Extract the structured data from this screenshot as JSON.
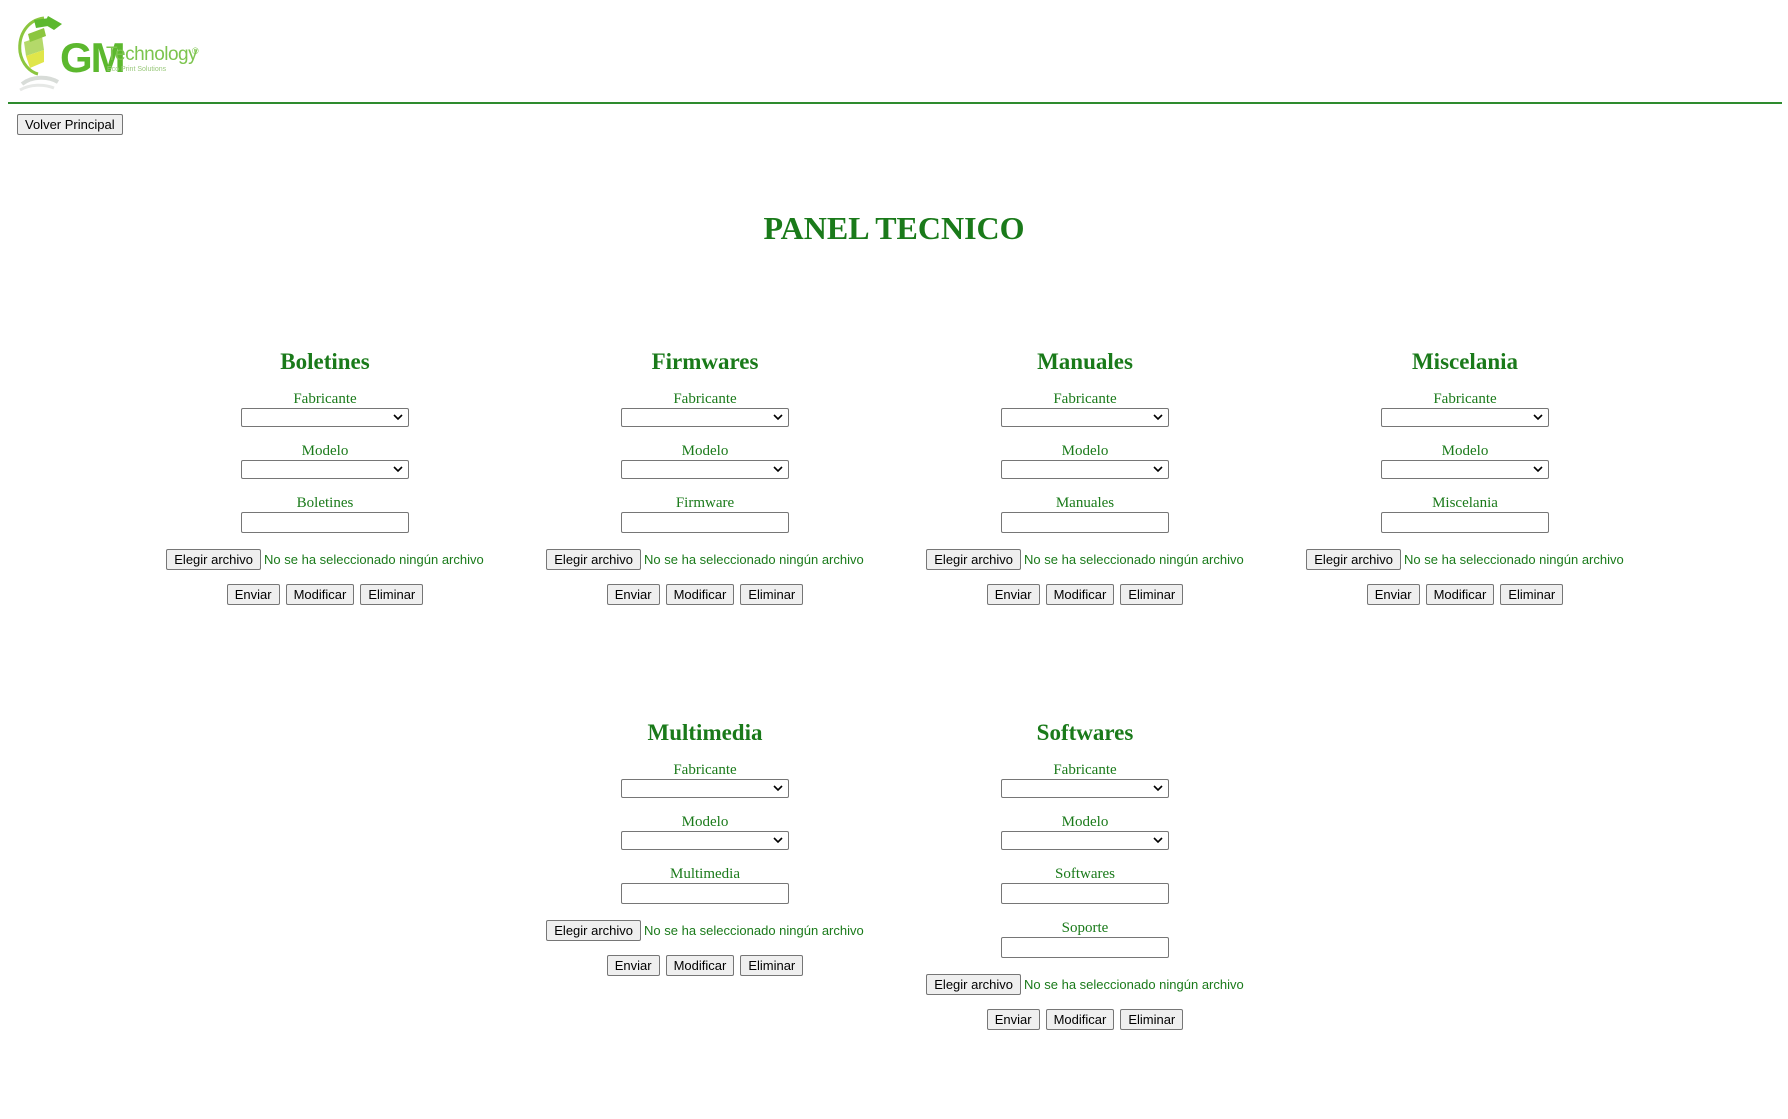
{
  "header": {
    "logo_gm": "GM",
    "logo_technology": "Technology",
    "logo_tagline": "Eco Print Solutions",
    "brand_color": "#5cb82e",
    "rule_color": "#2e8b2e"
  },
  "nav": {
    "back_label": "Volver Principal"
  },
  "page": {
    "title": "PANEL TECNICO",
    "text_color": "#1a7a1a"
  },
  "common": {
    "manufacturer_label": "Fabricante",
    "model_label": "Modelo",
    "choose_file_label": "Elegir archivo",
    "no_file_text": "No se ha seleccionado ningún archivo",
    "send_label": "Enviar",
    "modify_label": "Modificar",
    "delete_label": "Eliminar",
    "chevron_icon": "chevron-down-icon"
  },
  "sections": [
    {
      "title": "Boletines",
      "field_label": "Boletines"
    },
    {
      "title": "Firmwares",
      "field_label": "Firmware"
    },
    {
      "title": "Manuales",
      "field_label": "Manuales"
    },
    {
      "title": "Miscelania",
      "field_label": "Miscelania"
    },
    {
      "title": "Multimedia",
      "field_label": "Multimedia"
    },
    {
      "title": "Softwares",
      "field_label": "Softwares",
      "extra_label": "Soporte"
    }
  ]
}
